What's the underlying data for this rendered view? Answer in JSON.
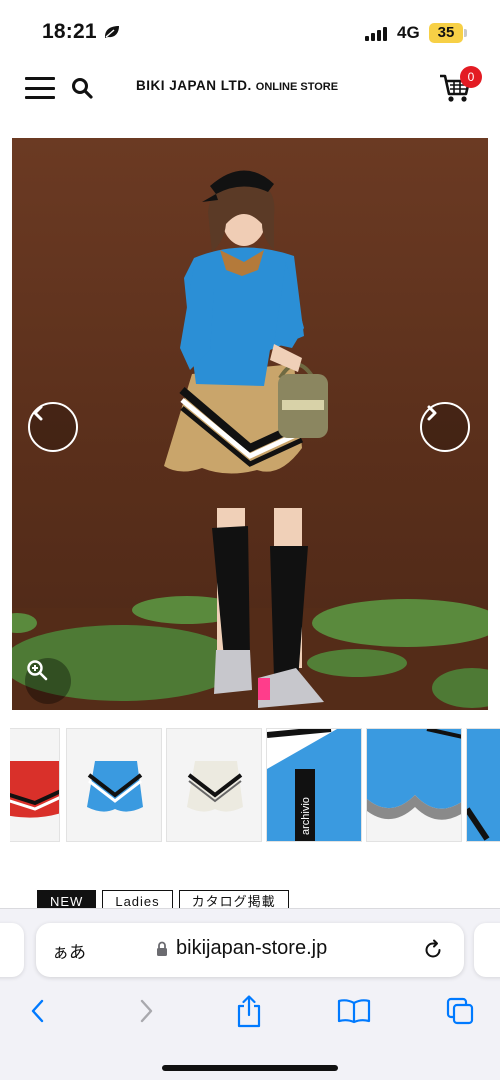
{
  "status_bar": {
    "time": "18:21",
    "network": "4G",
    "battery": "35"
  },
  "header": {
    "brand": "BIKI JAPAN LTD.",
    "brand_sub": "ONLINE STORE",
    "cart_count": "0"
  },
  "product": {
    "image_alt": "ARCHIVIO",
    "thumbnails": [
      "red-skirt",
      "blue-skirt",
      "white-skirt",
      "blue-detail-logo",
      "blue-hem-detail",
      "blue-edge"
    ]
  },
  "tags": [
    "NEW",
    "Ladies",
    "カタログ掲載"
  ],
  "browser": {
    "text_size_label": "ぁあ",
    "url": "bikijapan-store.jp"
  },
  "colors": {
    "accent": "#007aff",
    "cart_badge": "#e31b23",
    "backdrop": "#5e321d",
    "sweater": "#2b8fd6",
    "skirt": "#c9a56b"
  }
}
